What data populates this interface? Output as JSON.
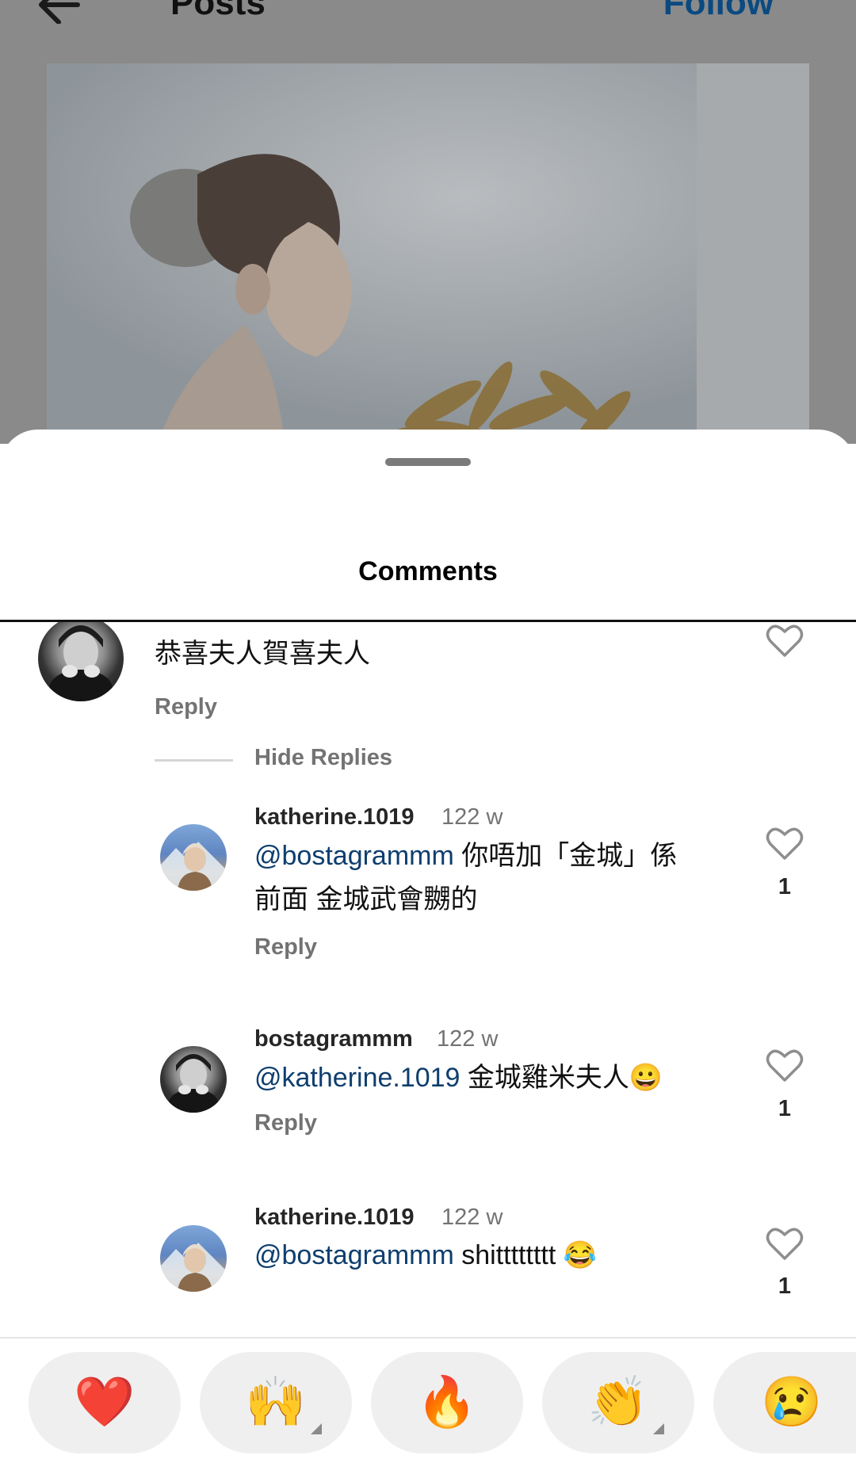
{
  "topbar": {
    "title": "Posts",
    "follow_label": "Follow"
  },
  "sheet": {
    "title": "Comments"
  },
  "comments": {
    "top": {
      "text": "恭喜夫人賀喜夫人",
      "reply_label": "Reply"
    },
    "hide_replies_label": "Hide Replies",
    "replies": [
      {
        "username": "katherine.1019",
        "time": "122 w",
        "mention": "@bostagrammm",
        "text_line1": " 你唔加「金城」係",
        "text_line2": "前面 金城武會嬲的",
        "emoji": "",
        "reply_label": "Reply",
        "likes": "1"
      },
      {
        "username": "bostagrammm",
        "time": "122 w",
        "mention": "@katherine.1019",
        "text_line1": " 金城雞米夫人",
        "emoji": "😀",
        "reply_label": "Reply",
        "likes": "1"
      },
      {
        "username": "katherine.1019",
        "time": "122 w",
        "mention": "@bostagrammm",
        "text_line1": " shitttttttt ",
        "emoji": "😂",
        "likes": "1"
      }
    ]
  },
  "reactions": [
    "❤️",
    "🙌",
    "🔥",
    "👏",
    "😢"
  ],
  "icons": {
    "back": "back-arrow-icon",
    "like": "heart-outline-icon"
  },
  "colors": {
    "mention": "#0e3e6e",
    "follow": "#0b4a80",
    "secondary_text": "#737373",
    "reaction_pill": "#efefef"
  }
}
